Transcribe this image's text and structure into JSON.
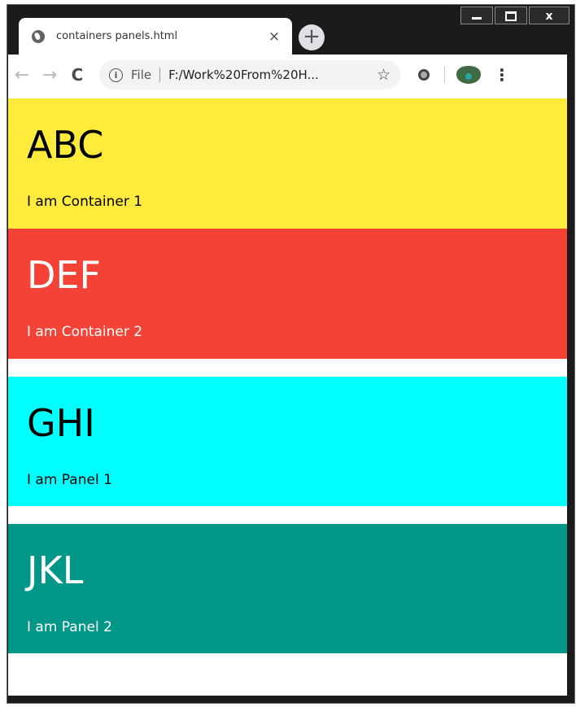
{
  "browser": {
    "tab": {
      "title": "containers panels.html",
      "close": "×",
      "icon": "globe-icon"
    },
    "new_tab": "+",
    "nav": {
      "back": "←",
      "forward": "→",
      "reload": "C"
    },
    "omnibox": {
      "info": "i",
      "scheme": "File",
      "url": "F:/Work%20From%20H...",
      "star": "☆"
    },
    "menu": "⋮",
    "window_controls": {
      "close": "x"
    }
  },
  "page": {
    "containers": [
      {
        "heading": "ABC",
        "text": "I am Container 1",
        "color": "#ffeb3b"
      },
      {
        "heading": "DEF",
        "text": "I am Container 2",
        "color": "#f44336"
      }
    ],
    "panels": [
      {
        "heading": "GHI",
        "text": "I am Panel 1",
        "color": "#00ffff"
      },
      {
        "heading": "JKL",
        "text": "I am Panel 2",
        "color": "#009688"
      }
    ]
  }
}
